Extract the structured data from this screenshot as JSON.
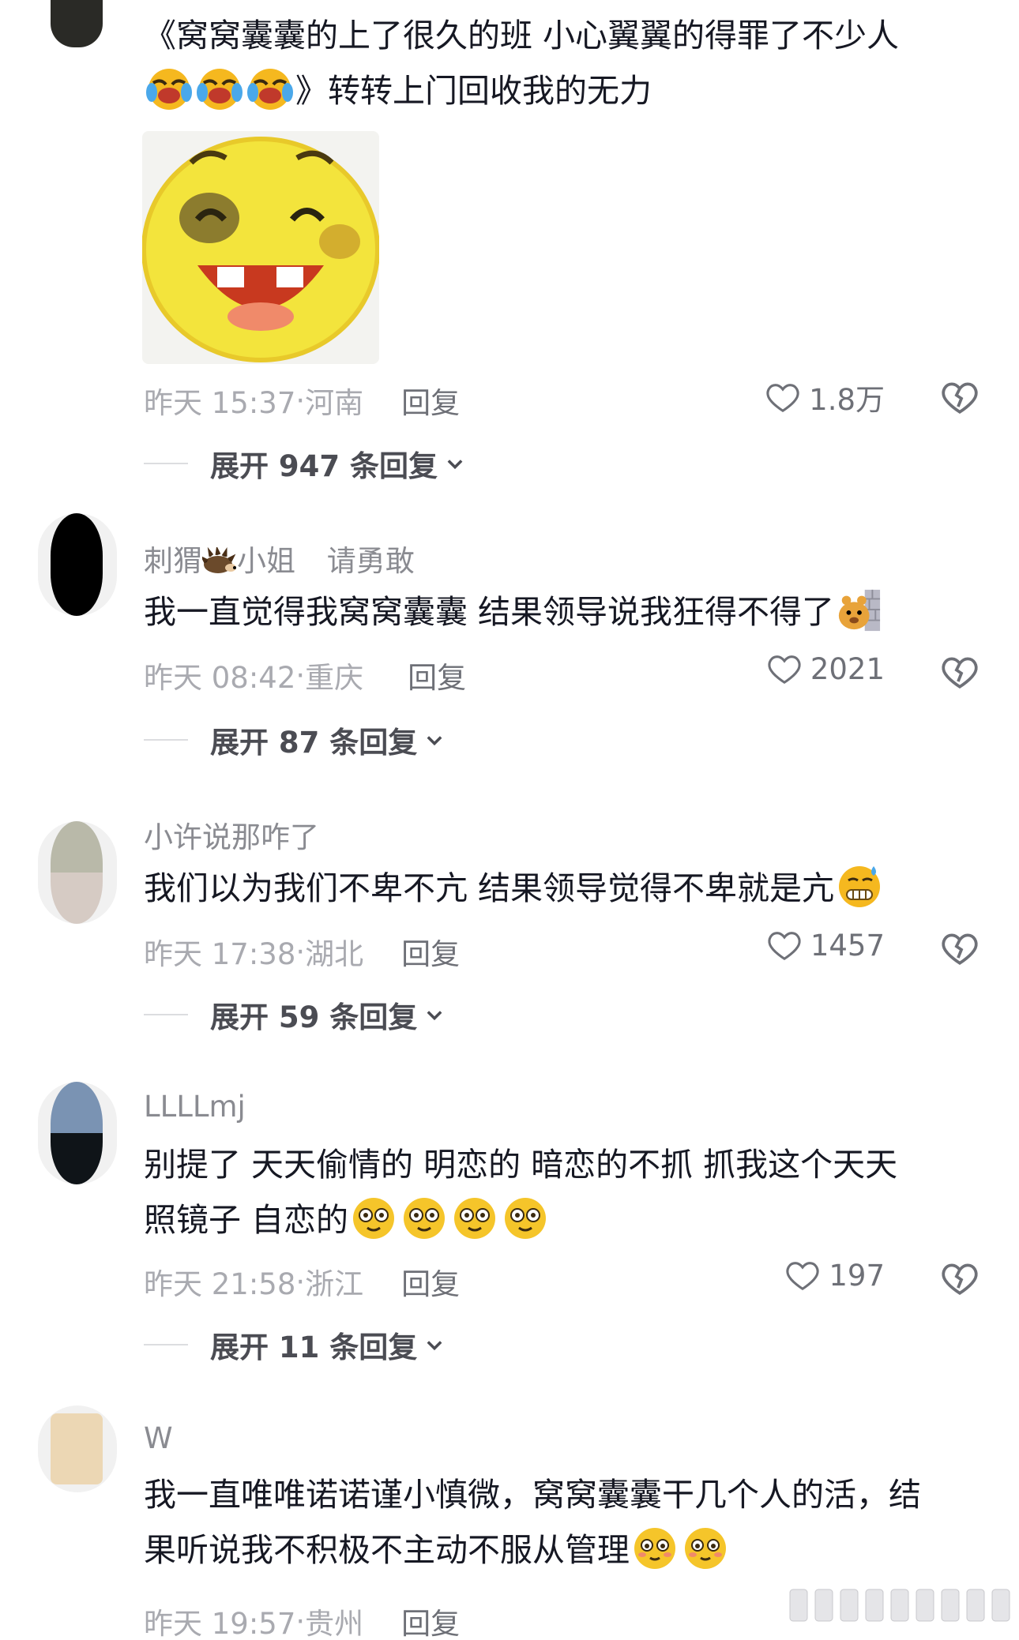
{
  "comments": [
    {
      "text_line1": "《窝窝囊囊的上了很久的班   小心翼翼的得罪了不少人",
      "text_line2": "》转转上门回收我的无力",
      "time": "昨天 15:37",
      "location": "河南",
      "reply": "回复",
      "likes": "1.8万",
      "expand": "展开 947 条回复"
    },
    {
      "username": "刺猬",
      "username_suffix": "小姐",
      "username_extra": "请勇敢",
      "text": "我一直觉得我窝窝囊囊   结果领导说我狂得不得了",
      "time": "昨天 08:42",
      "location": "重庆",
      "reply": "回复",
      "likes": "2021",
      "expand": "展开 87 条回复"
    },
    {
      "username": "小许说那咋了",
      "text": "我们以为我们不卑不亢 结果领导觉得不卑就是亢",
      "time": "昨天 17:38",
      "location": "湖北",
      "reply": "回复",
      "likes": "1457",
      "expand": "展开 59 条回复"
    },
    {
      "username": "LLLLmj",
      "text_line1": "别提了 天天偷情的 明恋的 暗恋的不抓  抓我这个天天",
      "text_line2": "照镜子 自恋的",
      "time": "昨天 21:58",
      "location": "浙江",
      "reply": "回复",
      "likes": "197",
      "expand": "展开 11 条回复"
    },
    {
      "username": "W",
      "text_line1": "我一直唯唯诺诺谨小慎微，窝窝囊囊干几个人的活，结",
      "text_line2": "果听说我不积极不主动不服从管理",
      "time": "昨天 19:57",
      "location": "贵州",
      "reply": "回复"
    }
  ],
  "colors": {
    "avatar_c2": "#000000",
    "avatar_c3_top": "#b9b9a9",
    "avatar_c3_bottom": "#d6cbc4",
    "avatar_c4_top": "#7a93b3",
    "avatar_c4_bottom": "#0f1418",
    "avatar_c5": "#ecd7b4"
  }
}
